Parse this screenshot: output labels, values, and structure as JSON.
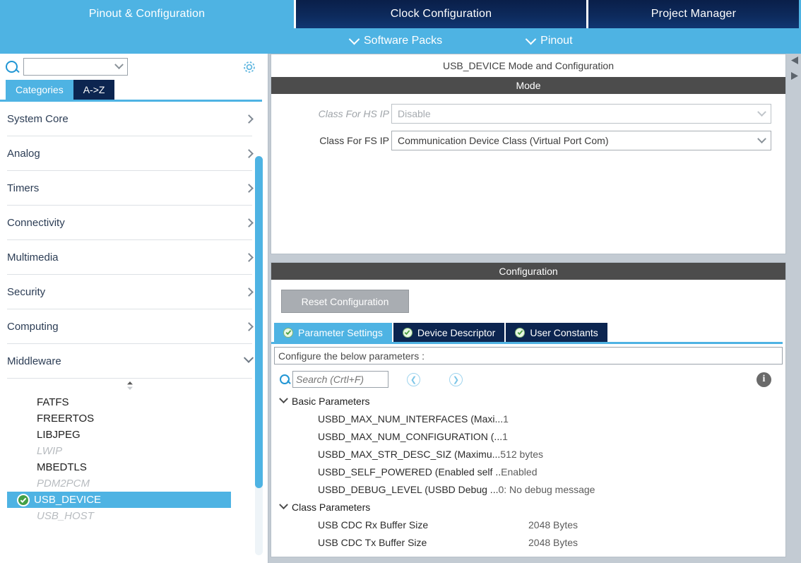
{
  "top_tabs": [
    {
      "label": "Pinout & Configuration",
      "active": true
    },
    {
      "label": "Clock Configuration",
      "active": false
    },
    {
      "label": "Project Manager",
      "active": false
    }
  ],
  "subbar": {
    "software_packs": "Software Packs",
    "pinout": "Pinout"
  },
  "sidebar": {
    "search_value": "",
    "gear_icon": "gear-icon",
    "tabs": [
      {
        "label": "Categories",
        "selected": true
      },
      {
        "label": "A->Z",
        "selected": false
      }
    ],
    "categories": [
      {
        "label": "System Core",
        "expanded": false
      },
      {
        "label": "Analog",
        "expanded": false
      },
      {
        "label": "Timers",
        "expanded": false
      },
      {
        "label": "Connectivity",
        "expanded": false
      },
      {
        "label": "Multimedia",
        "expanded": false
      },
      {
        "label": "Security",
        "expanded": false
      },
      {
        "label": "Computing",
        "expanded": false
      },
      {
        "label": "Middleware",
        "expanded": true
      }
    ],
    "middleware_items": [
      {
        "label": "FATFS",
        "state": "normal"
      },
      {
        "label": "FREERTOS",
        "state": "normal"
      },
      {
        "label": "LIBJPEG",
        "state": "normal"
      },
      {
        "label": "LWIP",
        "state": "disabled"
      },
      {
        "label": "MBEDTLS",
        "state": "normal"
      },
      {
        "label": "PDM2PCM",
        "state": "disabled"
      },
      {
        "label": "USB_DEVICE",
        "state": "selected"
      },
      {
        "label": "USB_HOST",
        "state": "disabled"
      }
    ]
  },
  "mode_panel": {
    "title": "USB_DEVICE Mode and Configuration",
    "band": "Mode",
    "rows": [
      {
        "label": "Class For HS IP",
        "value": "Disable",
        "disabled": true
      },
      {
        "label": "Class For FS IP",
        "value": "Communication Device Class (Virtual Port Com)",
        "disabled": false
      }
    ]
  },
  "config_panel": {
    "band": "Configuration",
    "reset_label": "Reset Configuration",
    "tabs": [
      {
        "label": "Parameter Settings",
        "selected": true
      },
      {
        "label": "Device Descriptor",
        "selected": false
      },
      {
        "label": "User Constants",
        "selected": false
      }
    ],
    "hint": "Configure the below parameters :",
    "search_placeholder": "Search (Crtl+F)",
    "search_value": "",
    "nav_prev_icon": "chevron-left-circle-icon",
    "nav_next_icon": "chevron-right-circle-icon",
    "info_icon": "info-icon",
    "groups": [
      {
        "label": "Basic Parameters",
        "expanded": true,
        "rows": [
          {
            "name": "USBD_MAX_NUM_INTERFACES (Maxi...",
            "value": "1"
          },
          {
            "name": "USBD_MAX_NUM_CONFIGURATION (... ",
            "value": "1"
          },
          {
            "name": "USBD_MAX_STR_DESC_SIZ (Maximu...",
            "value": "512 bytes"
          },
          {
            "name": "USBD_SELF_POWERED (Enabled self ..",
            "value": "Enabled"
          },
          {
            "name": "USBD_DEBUG_LEVEL (USBD Debug ... ",
            "value": "0: No debug message"
          }
        ]
      },
      {
        "label": "Class Parameters",
        "expanded": true,
        "fixed_columns": true,
        "rows": [
          {
            "name": "USB CDC Rx Buffer Size",
            "value": "2048 Bytes"
          },
          {
            "name": "USB CDC Tx Buffer Size",
            "value": "2048 Bytes"
          }
        ]
      }
    ]
  },
  "colors": {
    "accent_blue": "#4eb3e3",
    "navy": "#0c2550",
    "band_gray": "#4c4c4c",
    "panel_bg": "#c3cbd3"
  }
}
